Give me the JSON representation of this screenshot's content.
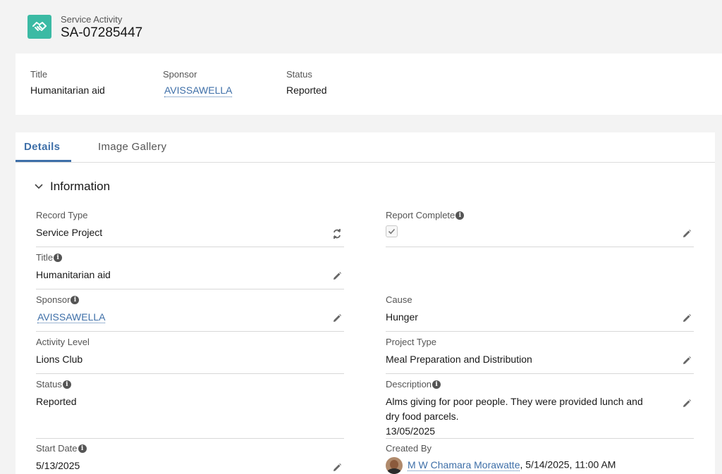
{
  "header": {
    "object_type": "Service Activity",
    "record_name": "SA-07285447",
    "icon": "handshake-icon",
    "icon_color": "#3bbaa4"
  },
  "highlights": {
    "title_label": "Title",
    "title_value": "Humanitarian aid",
    "sponsor_label": "Sponsor",
    "sponsor_value": "AVISSAWELLA",
    "status_label": "Status",
    "status_value": "Reported"
  },
  "tabs": [
    {
      "label": "Details",
      "active": true
    },
    {
      "label": "Image Gallery",
      "active": false
    }
  ],
  "section": {
    "title": "Information",
    "icon": "chevron-down-icon"
  },
  "fields": {
    "record_type": {
      "label": "Record Type",
      "value": "Service Project",
      "icon": "change-record-type-icon"
    },
    "report_complete": {
      "label": "Report Complete",
      "checked": true
    },
    "title": {
      "label": "Title",
      "value": "Humanitarian aid"
    },
    "sponsor": {
      "label": "Sponsor",
      "value": "AVISSAWELLA"
    },
    "cause": {
      "label": "Cause",
      "value": "Hunger"
    },
    "activity_level": {
      "label": "Activity Level",
      "value": "Lions Club"
    },
    "project_type": {
      "label": "Project Type",
      "value": "Meal Preparation and Distribution"
    },
    "status": {
      "label": "Status",
      "value": "Reported"
    },
    "description": {
      "label": "Description",
      "value_line1": "Alms giving for poor people. They were provided lunch and",
      "value_line2": "dry food parcels.",
      "value_line3": "13/05/2025"
    },
    "start_date": {
      "label": "Start Date",
      "value": "5/13/2025"
    },
    "created_by": {
      "label": "Created By",
      "user": "M W Chamara Morawatte",
      "timestamp": ", 5/14/2025, 11:00 AM"
    }
  },
  "colors": {
    "accent": "#3e6fa8",
    "background": "#f3f3f3",
    "panel": "#ffffff"
  }
}
